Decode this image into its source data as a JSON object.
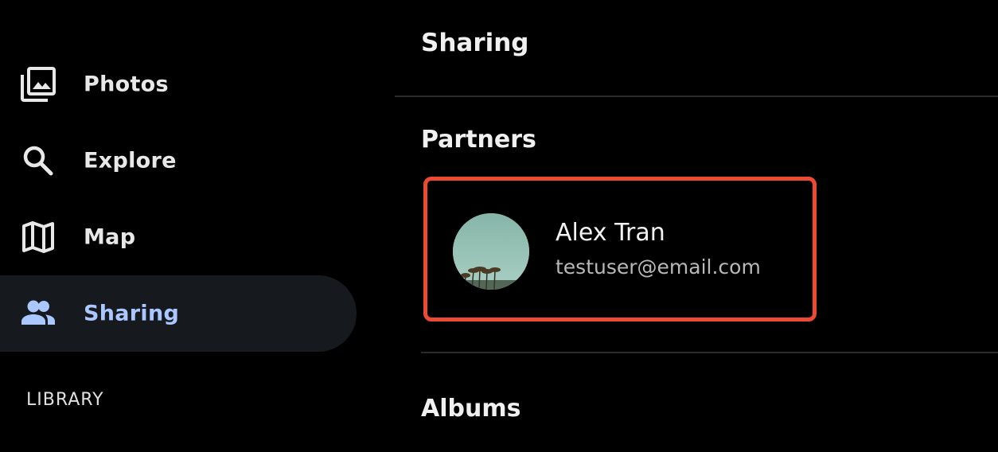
{
  "sidebar": {
    "items": [
      {
        "label": "Photos",
        "icon": "photos-icon",
        "active": false
      },
      {
        "label": "Explore",
        "icon": "search-icon",
        "active": false
      },
      {
        "label": "Map",
        "icon": "map-icon",
        "active": false
      },
      {
        "label": "Sharing",
        "icon": "people-icon",
        "active": true
      }
    ],
    "section_label": "LIBRARY"
  },
  "main": {
    "title": "Sharing",
    "partners": {
      "heading": "Partners",
      "items": [
        {
          "name": "Alex Tran",
          "email": "testuser@email.com",
          "avatar": "palm-trees-avatar"
        }
      ]
    },
    "albums": {
      "heading": "Albums"
    }
  },
  "colors": {
    "background": "#000000",
    "active_nav_bg": "#161a1f",
    "active_nav_text": "#aac7ff",
    "highlight_border": "#ec4a32"
  }
}
